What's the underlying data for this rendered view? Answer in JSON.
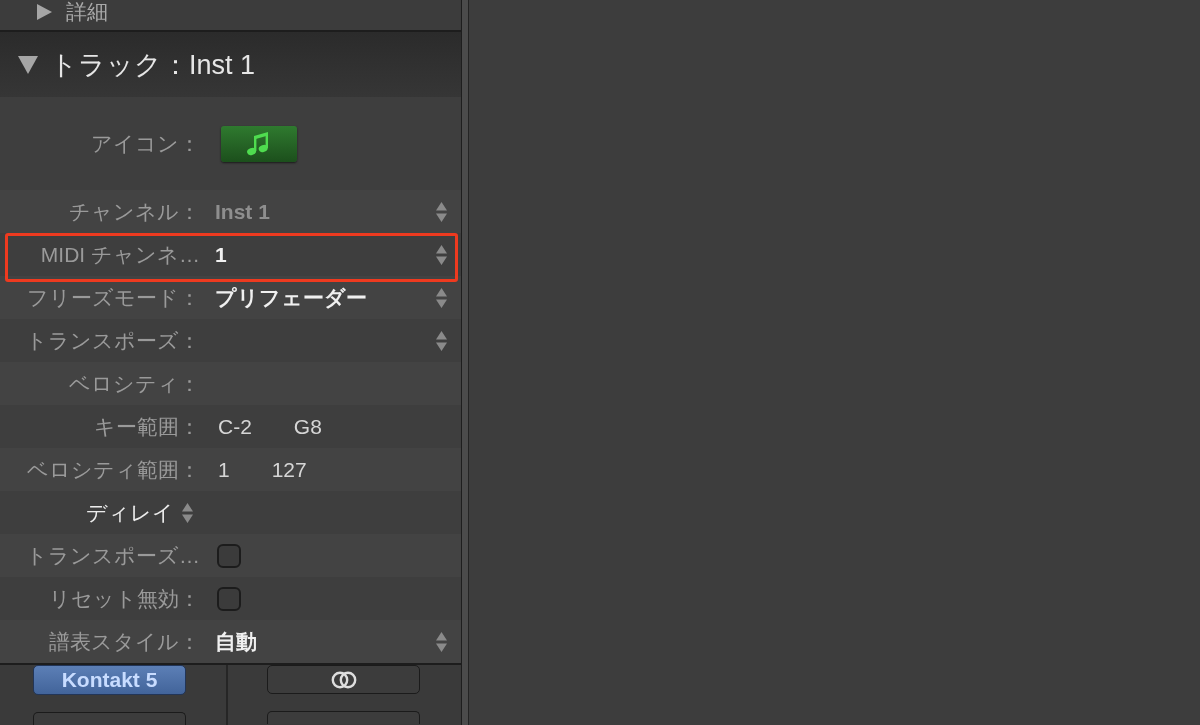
{
  "inspector": {
    "sections": [
      {
        "title": "詳細",
        "expanded": false
      },
      {
        "title": "トラック：Inst 1",
        "expanded": true,
        "rows": [
          {
            "kind": "icon",
            "label": "アイコン：",
            "highlighted": false
          },
          {
            "kind": "popup",
            "label": "チャンネル：",
            "value": "Inst 1",
            "disabled": true,
            "highlighted": false
          },
          {
            "kind": "popup",
            "label": "MIDI チャンネ…",
            "value": "1",
            "disabled": false,
            "highlighted": true
          },
          {
            "kind": "popup",
            "label": "フリーズモード：",
            "value": "プリフェーダー",
            "disabled": false,
            "highlighted": false
          },
          {
            "kind": "popup",
            "label": "トランスポーズ：",
            "highlighted": false
          },
          {
            "kind": "plain",
            "label": "ベロシティ：",
            "highlighted": false
          },
          {
            "kind": "values",
            "label": "キー範囲：",
            "values": [
              "C-2",
              "G8"
            ],
            "highlighted": false
          },
          {
            "kind": "values",
            "label": "ベロシティ範囲：",
            "values": [
              "1",
              "127"
            ],
            "highlighted": false
          },
          {
            "kind": "group",
            "label": "ディレイ",
            "highlighted": false
          },
          {
            "kind": "checkbox",
            "label": "トランスポーズ…",
            "checked": false,
            "highlighted": false
          },
          {
            "kind": "checkbox",
            "label": "リセット無効：",
            "checked": false,
            "highlighted": false
          },
          {
            "kind": "popup",
            "label": "譜表スタイル：",
            "value": "自動",
            "disabled": false,
            "highlighted": false
          }
        ]
      }
    ]
  },
  "channel_strips": [
    {
      "slots": [
        {
          "kind": "plugin",
          "label": "Kontakt 5"
        },
        {
          "kind": "empty"
        }
      ]
    },
    {
      "slots": [
        {
          "kind": "link"
        },
        {
          "kind": "empty"
        }
      ]
    }
  ]
}
